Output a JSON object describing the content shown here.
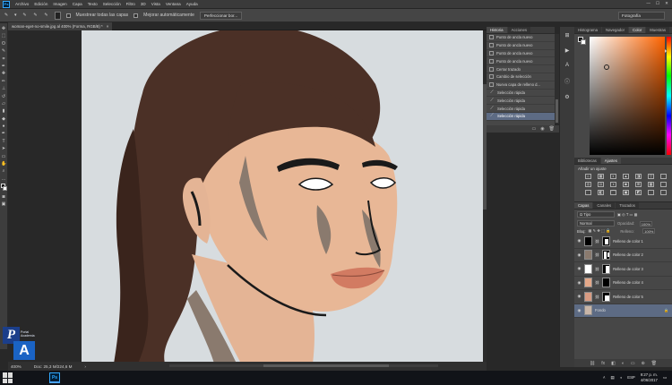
{
  "app": {
    "logo": "Ps"
  },
  "menu": [
    "Archivo",
    "Edición",
    "Imagen",
    "Capa",
    "Texto",
    "Selección",
    "Filtro",
    "3D",
    "Vista",
    "Ventana",
    "Ayuda"
  ],
  "window_controls": {
    "minimize": "—",
    "maximize": "☐",
    "close": "✕"
  },
  "options_bar": {
    "sample_all_layers": "Muestrear todas las capas",
    "auto_enhance": "Mejorar automáticamente",
    "refine_edge": "Perfeccionar bor...",
    "workspace": "Fotografía"
  },
  "document": {
    "tab_title": "woman-eget-no-smile.jpg al 400% (Forma, RGB/8) *",
    "close": "×"
  },
  "status": {
    "zoom": "400%",
    "doc_size": "Doc: 25,3 M/224,6 M",
    "arrow": "›"
  },
  "history": {
    "tabs": [
      "Historia",
      "Acciones"
    ],
    "items": [
      {
        "label": "Punto de ancla nuevo",
        "icon": "doc-icon",
        "selected": false
      },
      {
        "label": "Punto de ancla nuevo",
        "icon": "doc-icon",
        "selected": false
      },
      {
        "label": "Punto de ancla nuevo",
        "icon": "doc-icon",
        "selected": false
      },
      {
        "label": "Punto de ancla nuevo",
        "icon": "doc-icon",
        "selected": false
      },
      {
        "label": "Cerrar trazado",
        "icon": "doc-icon",
        "selected": false
      },
      {
        "label": "Cambio de selección",
        "icon": "doc-icon",
        "selected": false
      },
      {
        "label": "Nueva capa de relleno d...",
        "icon": "doc-icon",
        "selected": false
      },
      {
        "label": "Selección rápida",
        "icon": "brush-icon",
        "selected": false
      },
      {
        "label": "Selección rápida",
        "icon": "brush-icon",
        "selected": false
      },
      {
        "label": "Selección rápida",
        "icon": "brush-icon",
        "selected": false
      },
      {
        "label": "Selección rápida",
        "icon": "brush-icon",
        "selected": true
      }
    ]
  },
  "color_panel": {
    "tabs": [
      "Histograma",
      "Navegador",
      "Color",
      "Muestras"
    ],
    "active": "Color"
  },
  "adjustments": {
    "tabs": [
      "Bibliotecas",
      "Ajustes"
    ],
    "title": "Añadir un ajuste",
    "icons": [
      "☼",
      "▦",
      "◐",
      "▲",
      "◨",
      "▽",
      "",
      "◎",
      "⚖",
      "◑",
      "◙",
      "⊞",
      "▦",
      "",
      " ",
      "◧",
      "⌒",
      "▣",
      "◩",
      "",
      ""
    ]
  },
  "layers": {
    "tabs": [
      "Capas",
      "Canales",
      "Trazados"
    ],
    "filter": "Ω Tipo",
    "blend": "Normal",
    "opacity_label": "Opacidad:",
    "opacity": "100%",
    "lock_label": "Bloq:",
    "fill_label": "Relleno:",
    "fill": "100%",
    "items": [
      {
        "name": "Relleno de color 1",
        "color": "#000000",
        "selected": false
      },
      {
        "name": "Relleno de color 2",
        "color": "#8a7a6e",
        "selected": false
      },
      {
        "name": "Relleno de color 3",
        "color": "#ffffff",
        "selected": false
      },
      {
        "name": "Relleno de color 4",
        "color": "#e4a889",
        "selected": false
      },
      {
        "name": "Relleno de color 5",
        "color": "#d89b82",
        "selected": false
      },
      {
        "name": "Fondo",
        "color": "#c9b6a8",
        "selected": true
      }
    ],
    "footer_icons": [
      "⛓",
      "fx",
      "◧",
      "◐",
      "▭",
      "⊕",
      "🗑"
    ]
  },
  "taskbar": {
    "lang": "ESP",
    "time": "9:27 p. m.",
    "date": "4/06/2017"
  },
  "watermark": {
    "p": "P",
    "a": "A",
    "small": "Portal Academia"
  }
}
